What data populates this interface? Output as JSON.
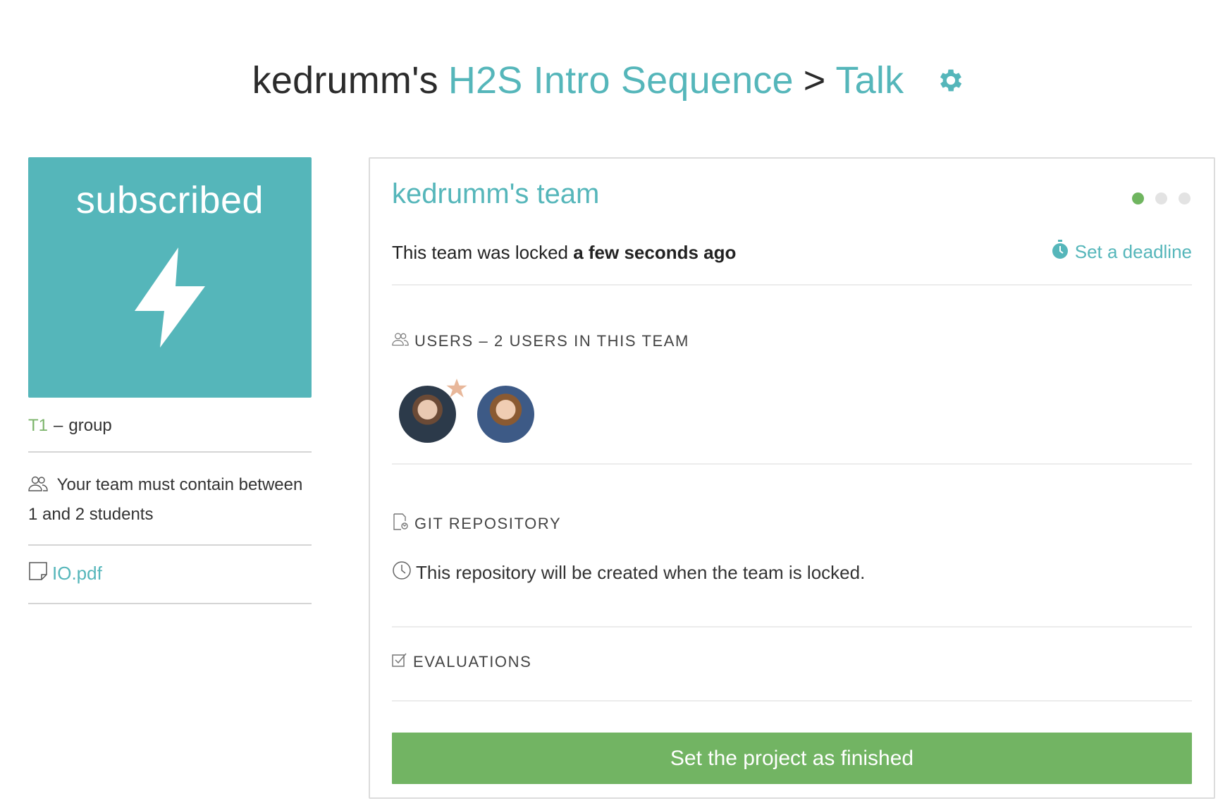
{
  "header": {
    "owner": "kedrumm's",
    "project": "H2S Intro Sequence",
    "separator": ">",
    "activity": "Talk",
    "settings_icon": "gear-icon"
  },
  "left": {
    "status": "subscribed",
    "status_icon": "lightning-bolt-icon",
    "group_code": "T1",
    "group_dash": "–",
    "group_type": "group",
    "team_rule": "Your team must contain between 1 and 2 students",
    "attachment": "IO.pdf"
  },
  "team": {
    "name": "kedrumm's team",
    "steps_total": 3,
    "steps_active": 1,
    "locked_prefix": "This team was locked",
    "locked_time": "a few seconds ago",
    "deadline_label": "Set a deadline"
  },
  "users": {
    "title": "USERS – 2 USERS IN THIS TEAM",
    "members": [
      "leader-avatar",
      "member-avatar"
    ]
  },
  "git": {
    "title": "GIT REPOSITORY",
    "note": "This repository will be created when the team is locked."
  },
  "evaluations": {
    "title": "EVALUATIONS"
  },
  "actions": {
    "finish_label": "Set the project as finished"
  },
  "colors": {
    "accent": "#55b6ba",
    "success": "#72b463",
    "code": "#7bb46a",
    "star": "#e8b79a"
  }
}
